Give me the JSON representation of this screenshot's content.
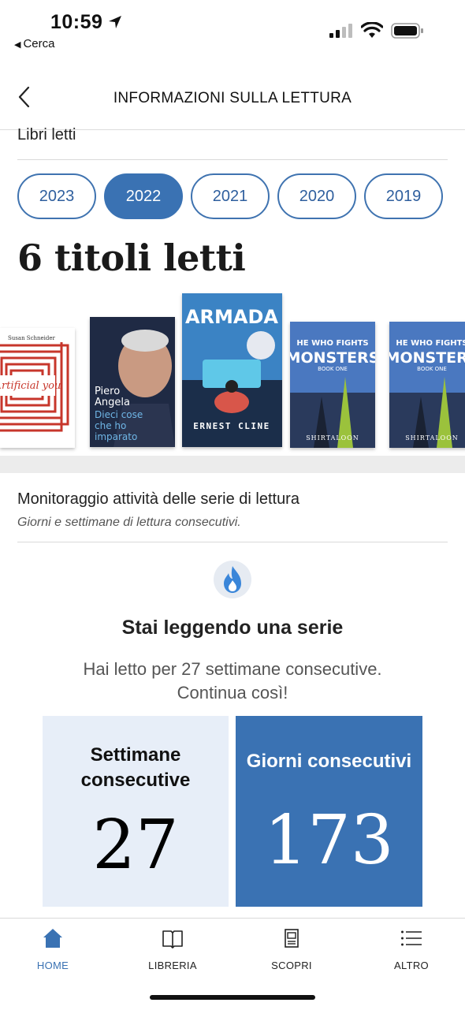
{
  "status_bar": {
    "time": "10:59",
    "back_app": "Cerca"
  },
  "header": {
    "title": "INFORMAZIONI SULLA LETTURA"
  },
  "books_read": {
    "section_label": "Libri letti",
    "years": [
      "2023",
      "2022",
      "2021",
      "2020",
      "2019"
    ],
    "selected_year": "2022",
    "count_text": "6 titoli letti",
    "covers": [
      {
        "title": "Artificial you",
        "author": "Susan Schneider"
      },
      {
        "title": "Dieci cose che ho imparato",
        "author": "Piero Angela"
      },
      {
        "title": "ARMADA",
        "author": "ERNEST CLINE"
      },
      {
        "title": "HE WHO FIGHTS MONSTERS",
        "subtitle": "BOOK ONE",
        "author": "SHIRTALOON"
      },
      {
        "title": "HE WHO FIGHTS MONSTERS",
        "subtitle": "BOOK ONE",
        "author": "SHIRTALOON"
      }
    ]
  },
  "streak": {
    "section_title": "Monitoraggio attività delle serie di lettura",
    "section_subtitle": "Giorni e settimane di lettura consecutivi.",
    "icon": "flame-icon",
    "title": "Stai leggendo una serie",
    "desc_line1": "Hai letto per 27 settimane consecutive.",
    "desc_line2": "Continua così!",
    "weeks_label_line1": "Settimane",
    "weeks_label_line2": "consecutive",
    "weeks_value": "27",
    "days_label": "Giorni consecutivi",
    "days_value": "173"
  },
  "tabs": [
    {
      "label": "HOME",
      "icon": "home-icon",
      "active": true
    },
    {
      "label": "LIBRERIA",
      "icon": "book-icon",
      "active": false
    },
    {
      "label": "SCOPRI",
      "icon": "discover-icon",
      "active": false
    },
    {
      "label": "ALTRO",
      "icon": "menu-icon",
      "active": false
    }
  ],
  "colors": {
    "accent": "#3a72b3",
    "accent_light": "#e7eef8"
  }
}
